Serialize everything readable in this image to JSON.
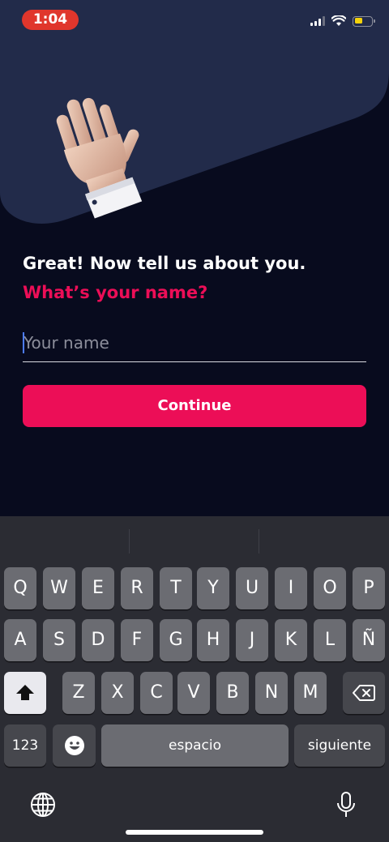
{
  "status_bar": {
    "time": "1:04",
    "icons": [
      "cellular-signal-icon",
      "wifi-icon",
      "battery-icon"
    ],
    "battery_color": "#f5d30b",
    "time_pill_color": "#e0362c"
  },
  "hero": {
    "illustration": "waving-hand-icon"
  },
  "form": {
    "headline": "Great! Now tell us about you.",
    "question": "What’s your name?",
    "name_placeholder": "Your name",
    "name_value": "",
    "continue_label": "Continue"
  },
  "keyboard": {
    "row1": [
      "Q",
      "W",
      "E",
      "R",
      "T",
      "Y",
      "U",
      "I",
      "O",
      "P"
    ],
    "row2": [
      "A",
      "S",
      "D",
      "F",
      "G",
      "H",
      "J",
      "K",
      "L",
      "Ñ"
    ],
    "row3": [
      "Z",
      "X",
      "C",
      "V",
      "B",
      "N",
      "M"
    ],
    "numbers_label": "123",
    "space_label": "espacio",
    "return_label": "siguiente",
    "icons": [
      "shift-icon",
      "backspace-icon",
      "emoji-icon",
      "globe-icon",
      "microphone-icon"
    ]
  },
  "colors": {
    "accent": "#ec0e57",
    "background": "#080b1e",
    "hero_panel": "#222b4a",
    "keyboard_bg": "#2b2c33"
  }
}
